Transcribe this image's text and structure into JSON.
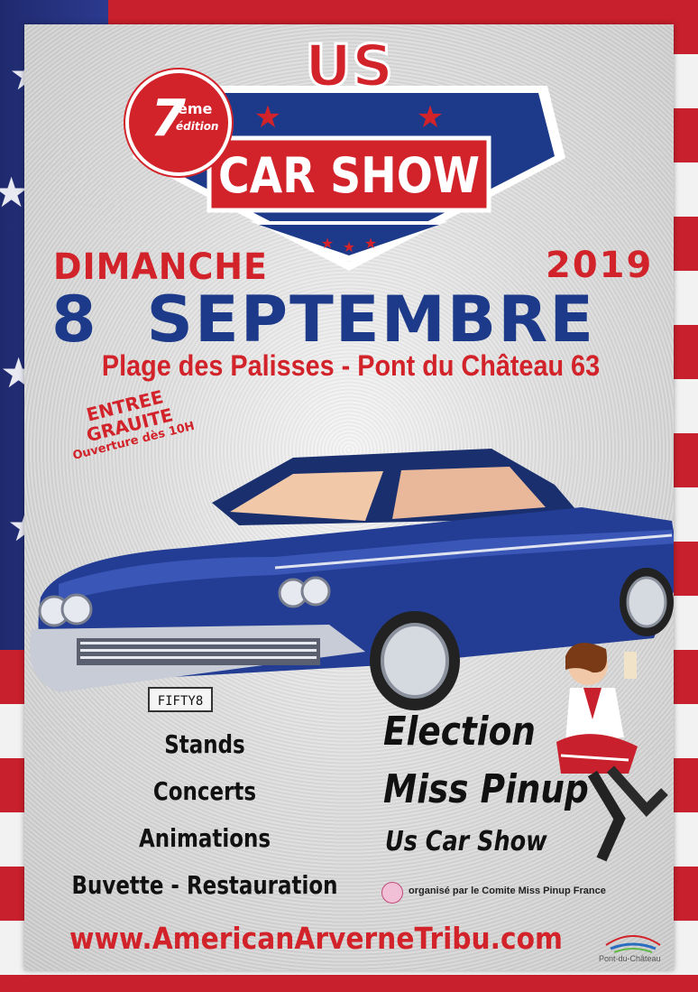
{
  "logo": {
    "edition_number": "7",
    "edition_suffix": "ème",
    "edition_word": "édition",
    "title_top": "US",
    "title_bottom": "CAR SHOW"
  },
  "event": {
    "day_name": "DIMANCHE",
    "year": "2019",
    "date": "8  SEPTEMBRE",
    "location": "Plage des Palisses - Pont du Château 63"
  },
  "entry": {
    "line1": "ENTREE",
    "line2": "GRAUITE",
    "line3": "Ouverture dès 10H"
  },
  "car": {
    "plate": "FIFTY8"
  },
  "activities": [
    "Stands",
    "Concerts",
    "Animations",
    "Buvette - Restauration"
  ],
  "pinup": {
    "line1": "Election",
    "line2": "Miss Pinup",
    "line3": "Us Car Show",
    "organiser": "organisé par le Comite Miss Pinup France"
  },
  "footer": {
    "website": "www.AmericanArverneTribu.com",
    "town_logo": "Pont-du-Château"
  },
  "colors": {
    "red": "#d2232a",
    "blue": "#1d3a8a",
    "flag_blue": "#1f2a6e"
  }
}
